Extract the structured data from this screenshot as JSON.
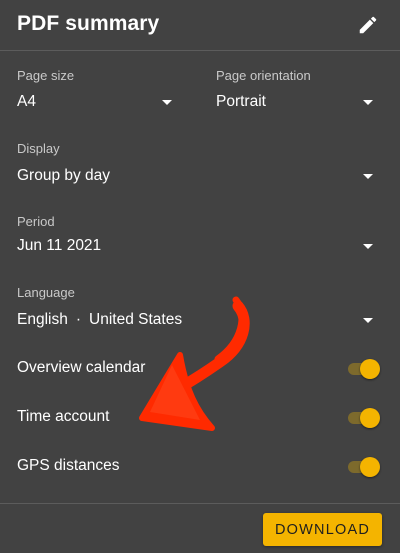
{
  "header": {
    "title": "PDF summary",
    "edit_icon": "pencil-icon"
  },
  "page_size": {
    "label": "Page size",
    "value": "A4"
  },
  "page_orientation": {
    "label": "Page orientation",
    "value": "Portrait"
  },
  "display": {
    "label": "Display",
    "value": "Group by day"
  },
  "period": {
    "label": "Period",
    "value": "Jun 11 2021"
  },
  "language": {
    "label": "Language",
    "language": "English",
    "separator": "·",
    "region": "United States"
  },
  "toggles": [
    {
      "label": "Overview calendar",
      "on": true
    },
    {
      "label": "Time account",
      "on": true
    },
    {
      "label": "GPS distances",
      "on": true
    }
  ],
  "footer": {
    "download_label": "DOWNLOAD"
  },
  "colors": {
    "background": "#424242",
    "accent": "#f4b400",
    "annotation": "#ff2a00"
  }
}
